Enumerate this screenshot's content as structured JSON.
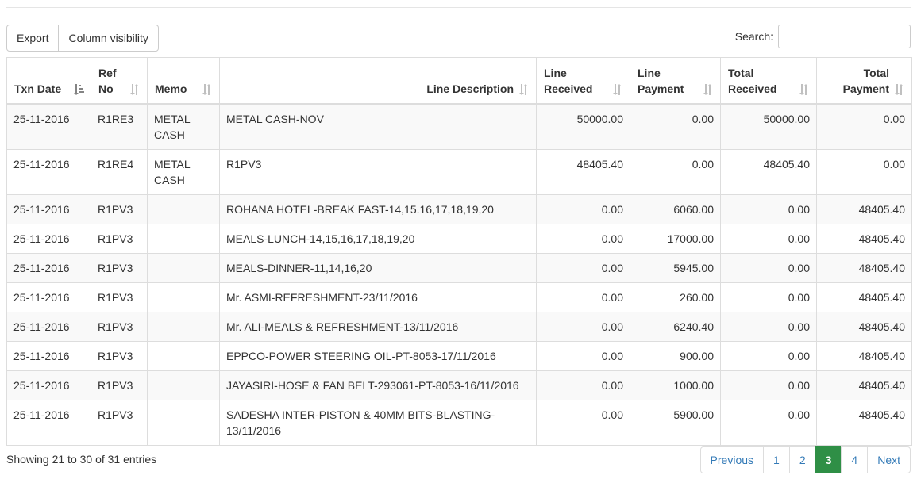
{
  "toolbar": {
    "export_label": "Export",
    "column_visibility_label": "Column visibility"
  },
  "search": {
    "label": "Search:",
    "value": "",
    "placeholder": ""
  },
  "table": {
    "columns": [
      "Txn Date",
      "Ref No",
      "Memo",
      "Line Description",
      "Line Received",
      "Line Payment",
      "Total Received",
      "Total Payment"
    ],
    "rows": [
      [
        "25-11-2016",
        "R1RE3",
        "METAL CASH",
        "METAL CASH-NOV",
        "50000.00",
        "0.00",
        "50000.00",
        "0.00"
      ],
      [
        "25-11-2016",
        "R1RE4",
        "METAL CASH",
        "R1PV3",
        "48405.40",
        "0.00",
        "48405.40",
        "0.00"
      ],
      [
        "25-11-2016",
        "R1PV3",
        "",
        "ROHANA HOTEL-BREAK FAST-14,15.16,17,18,19,20",
        "0.00",
        "6060.00",
        "0.00",
        "48405.40"
      ],
      [
        "25-11-2016",
        "R1PV3",
        "",
        "MEALS-LUNCH-14,15,16,17,18,19,20",
        "0.00",
        "17000.00",
        "0.00",
        "48405.40"
      ],
      [
        "25-11-2016",
        "R1PV3",
        "",
        "MEALS-DINNER-11,14,16,20",
        "0.00",
        "5945.00",
        "0.00",
        "48405.40"
      ],
      [
        "25-11-2016",
        "R1PV3",
        "",
        "Mr. ASMI-REFRESHMENT-23/11/2016",
        "0.00",
        "260.00",
        "0.00",
        "48405.40"
      ],
      [
        "25-11-2016",
        "R1PV3",
        "",
        "Mr. ALI-MEALS & REFRESHMENT-13/11/2016",
        "0.00",
        "6240.40",
        "0.00",
        "48405.40"
      ],
      [
        "25-11-2016",
        "R1PV3",
        "",
        "EPPCO-POWER STEERING OIL-PT-8053-17/11/2016",
        "0.00",
        "900.00",
        "0.00",
        "48405.40"
      ],
      [
        "25-11-2016",
        "R1PV3",
        "",
        "JAYASIRI-HOSE & FAN BELT-293061-PT-8053-16/11/2016",
        "0.00",
        "1000.00",
        "0.00",
        "48405.40"
      ],
      [
        "25-11-2016",
        "R1PV3",
        "",
        "SADESHA INTER-PISTON & 40MM BITS-BLASTING-13/11/2016",
        "0.00",
        "5900.00",
        "0.00",
        "48405.40"
      ]
    ]
  },
  "footer": {
    "info": "Showing 21 to 30 of 31 entries"
  },
  "pagination": {
    "previous": "Previous",
    "pages": [
      "1",
      "2",
      "3",
      "4"
    ],
    "active": "3",
    "next": "Next"
  },
  "colors": {
    "active_page": "#2f8f46",
    "link": "#337ab7",
    "stripe": "#f9f9f9",
    "border": "#dddddd"
  },
  "icons": {
    "sort_active": "sort-asc-icon",
    "sort": "sort-both-icon"
  }
}
